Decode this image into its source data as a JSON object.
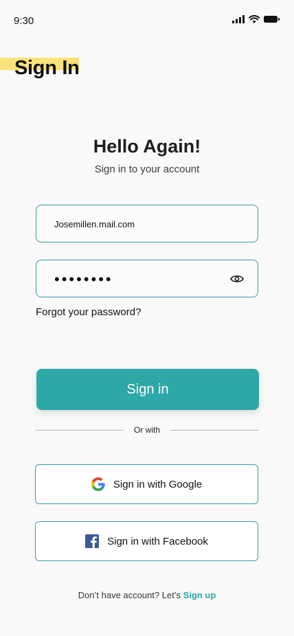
{
  "status_bar": {
    "time": "9:30",
    "icons": [
      "signal-icon",
      "wifi-icon",
      "battery-icon"
    ]
  },
  "header": {
    "title": "Sign In",
    "highlight_color": "#fbe17a"
  },
  "greeting": {
    "title": "Hello Again!",
    "subtitle": "Sign in to your account"
  },
  "form": {
    "email_value": "Josemillen.mail.com",
    "password_value": "••••••••",
    "password_toggle_icon": "eye-icon",
    "forgot_label": "Forgot your password?",
    "submit_label": "Sign in"
  },
  "divider": {
    "label": "Or with"
  },
  "social": {
    "google_label": "Sign in with Google",
    "google_icon": "google-icon",
    "facebook_label": "Sign in with Facebook",
    "facebook_icon": "facebook-icon"
  },
  "footer": {
    "prompt": "Don’t have account? Let’s",
    "link_label": "Sign up"
  },
  "colors": {
    "accent": "#2ea7a8",
    "border": "#3a9aa0",
    "facebook_blue": "#3b5998"
  }
}
